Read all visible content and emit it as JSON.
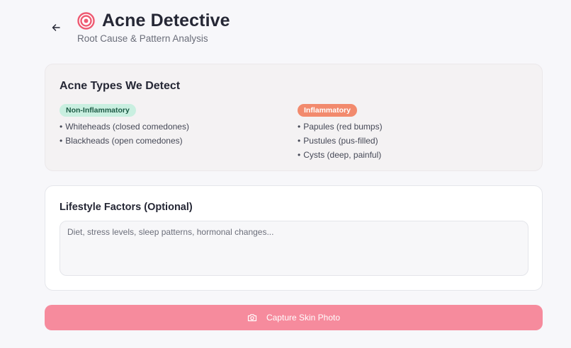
{
  "header": {
    "title": "Acne Detective",
    "subtitle": "Root Cause & Pattern Analysis",
    "icon": "target-icon",
    "back_icon": "arrow-left-icon"
  },
  "acne_types": {
    "title": "Acne Types We Detect",
    "non_inflammatory": {
      "label": "Non-Inflammatory",
      "items": [
        "Whiteheads (closed comedones)",
        "Blackheads (open comedones)"
      ]
    },
    "inflammatory": {
      "label": "Inflammatory",
      "items": [
        "Papules (red bumps)",
        "Pustules (pus-filled)",
        "Cysts (deep, painful)"
      ]
    }
  },
  "lifestyle": {
    "title": "Lifestyle Factors (Optional)",
    "placeholder": "Diet, stress levels, sleep patterns, hormonal changes...",
    "value": ""
  },
  "capture": {
    "label": "Capture Skin Photo",
    "icon": "camera-icon"
  },
  "colors": {
    "accent": "#f68b9d",
    "non_inflammatory_badge": "#c9efe0",
    "inflammatory_badge": "#f28a6d"
  }
}
